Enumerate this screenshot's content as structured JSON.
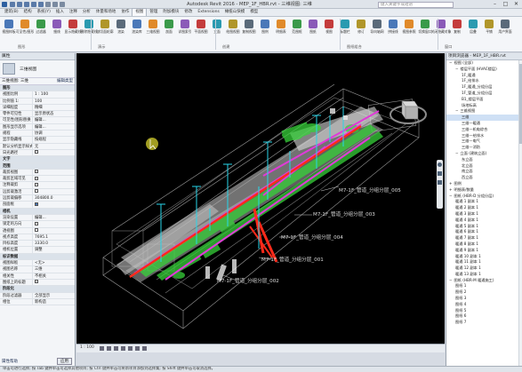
{
  "titlebar": {
    "title": "Autodesk Revit 2016 -    MEP_1F_HBR.rvt - 三维视图: 三维",
    "search_placeholder": "键入关键字或短语"
  },
  "tabs": [
    "建筑(B)",
    "结构",
    "系统(Y)",
    "插入",
    "注释",
    "分析",
    "体量和场地",
    "协作",
    "视图",
    "管理",
    "附加模块",
    "修改",
    "Extensions",
    "橄榄山快模",
    "模型"
  ],
  "active_tab_index": 8,
  "ribbon": {
    "buttons": [
      "视图样板",
      "可见性/图形",
      "过滤器",
      "细线",
      "显示隐藏线",
      "删除隐藏线",
      "剖切面轮廓",
      "渲染",
      "渲染库",
      "三维视图",
      "剖面",
      "详图索引",
      "平面视图",
      "立面",
      "绘图视图",
      "复制视图",
      "图例",
      "明细表",
      "范围框",
      "图纸",
      "视图",
      "标题栏",
      "修订",
      "导向轴网",
      "拼接线",
      "视图参照",
      "切换窗口",
      "关闭隐藏对象",
      "复制",
      "层叠",
      "平铺",
      "用户界面"
    ],
    "panels": [
      "图形",
      "演示",
      "创建",
      "图纸组合",
      "窗口"
    ]
  },
  "properties": {
    "header": "属性",
    "type_name": "三维视图",
    "selector_value": "三维视图: 三维",
    "edit_type": "编辑类型",
    "groups": [
      {
        "title": "图形",
        "rows": [
          [
            "视图比例",
            "1 : 100"
          ],
          [
            "比例值 1:",
            "100"
          ],
          [
            "详细程度",
            "精细"
          ],
          [
            "零件可见性",
            "显示原状态"
          ],
          [
            "可见性/图形替换",
            "编辑..."
          ],
          [
            "图形显示选项",
            "编辑..."
          ],
          [
            "规程",
            "协调"
          ],
          [
            "显示隐藏线",
            "按规程"
          ],
          [
            "默认分析显示样式",
            "无"
          ],
          [
            "日光路径",
            ""
          ]
        ]
      },
      {
        "title": "文字",
        "rows": []
      },
      {
        "title": "范围",
        "rows": [
          [
            "裁剪视图",
            ""
          ],
          [
            "裁剪区域可见",
            ""
          ],
          [
            "注释裁剪",
            ""
          ],
          [
            "远剪裁激活",
            ""
          ],
          [
            "远剪裁偏移",
            "304800.0"
          ],
          [
            "剖面框",
            "on"
          ]
        ]
      },
      {
        "title": "相机",
        "rows": [
          [
            "渲染设置",
            "编辑..."
          ],
          [
            "锁定的方向",
            ""
          ],
          [
            "透视图",
            ""
          ],
          [
            "视点高度",
            "7695.1"
          ],
          [
            "目标高度",
            "3330.0"
          ],
          [
            "相机位置",
            "调整"
          ]
        ]
      },
      {
        "title": "标识数据",
        "rows": [
          [
            "视图样板",
            "<无>"
          ],
          [
            "视图名称",
            "三维"
          ],
          [
            "相关性",
            "不相关"
          ],
          [
            "图纸上的标题",
            ""
          ]
        ]
      },
      {
        "title": "阶段化",
        "rows": [
          [
            "阶段过滤器",
            "全部显示"
          ],
          [
            "相位",
            "新构造"
          ]
        ]
      }
    ],
    "help_link": "属性帮助",
    "apply": "应用"
  },
  "viewport": {
    "tags": [
      "M7-1F_管道_分组分层_005",
      "M7-1F_管道_分组分层_003",
      "M7-1F_管道_分组分层_004",
      "M7-1F_管道_分组分层_001",
      "M7-1F_管道_分组分层_002"
    ],
    "scale": "1 : 100"
  },
  "browser": {
    "header": "项目浏览器 - MEP_1F_HBR.rvt",
    "nodes": [
      {
        "label": "视图 (全部)",
        "level": 0,
        "toggle": "−"
      },
      {
        "label": "楼层平面 (HVAC楼层)",
        "level": 1,
        "toggle": "−"
      },
      {
        "label": "1F_暖通",
        "level": 2
      },
      {
        "label": "1F_给排水",
        "level": 2
      },
      {
        "label": "1F_暖通_分组分层",
        "level": 2
      },
      {
        "label": "1F_管道_分组分层",
        "level": 2
      },
      {
        "label": "B1_楼层平面",
        "level": 2
      },
      {
        "label": "场地标高",
        "level": 2
      },
      {
        "label": "三维视图",
        "level": 1,
        "toggle": "−"
      },
      {
        "label": "三维",
        "level": 2,
        "selected": true
      },
      {
        "label": "三维—暖通",
        "level": 2
      },
      {
        "label": "三维—机电综合",
        "level": 2
      },
      {
        "label": "三维—给排水",
        "level": 2
      },
      {
        "label": "三维—电气",
        "level": 2
      },
      {
        "label": "三维—消防",
        "level": 2
      },
      {
        "label": "立面 (建筑立面)",
        "level": 1,
        "toggle": "−"
      },
      {
        "label": "东立面",
        "level": 2
      },
      {
        "label": "北立面",
        "level": 2
      },
      {
        "label": "南立面",
        "level": 2
      },
      {
        "label": "西立面",
        "level": 2
      },
      {
        "label": "图例",
        "level": 0,
        "toggle": "+"
      },
      {
        "label": "明细表/数量",
        "level": 0,
        "toggle": "+"
      },
      {
        "label": "图纸 (HBR-D 分组分层)",
        "level": 0,
        "toggle": "−"
      },
      {
        "label": "暖通 1 副本 1",
        "level": 1
      },
      {
        "label": "暖通 2 副本 1",
        "level": 1
      },
      {
        "label": "暖通 3 副本 1",
        "level": 1
      },
      {
        "label": "暖通 4 副本 1",
        "level": 1
      },
      {
        "label": "暖通 5 副本 1",
        "level": 1
      },
      {
        "label": "暖通 6 副本 1",
        "level": 1
      },
      {
        "label": "暖通 7 副本 1",
        "level": 1
      },
      {
        "label": "暖通 8 副本 1",
        "level": 1
      },
      {
        "label": "暖通 9 副本 1",
        "level": 1
      },
      {
        "label": "暖通 10 副本 1",
        "level": 1
      },
      {
        "label": "暖通 11 副本 1",
        "level": 1
      },
      {
        "label": "暖通 12 副本 1",
        "level": 1
      },
      {
        "label": "暖通 13 副本 1",
        "level": 1
      },
      {
        "label": "图纸 (HBR-M 暖通施工)",
        "level": 0,
        "toggle": "−"
      },
      {
        "label": "图纸 1",
        "level": 1
      },
      {
        "label": "图纸 2",
        "level": 1
      },
      {
        "label": "图纸 3",
        "level": 1
      },
      {
        "label": "图纸 4",
        "level": 1
      },
      {
        "label": "图纸 5",
        "level": 1
      },
      {
        "label": "图纸 6",
        "level": 1
      },
      {
        "label": "图纸 7",
        "level": 1
      }
    ]
  },
  "status": "单击可进行选择; 按 Tab 键并单击可选择其他项目; 按 Ctrl 键并单击可将新项目添加到选择集; 按 Shift 键并单击可取消选择。"
}
